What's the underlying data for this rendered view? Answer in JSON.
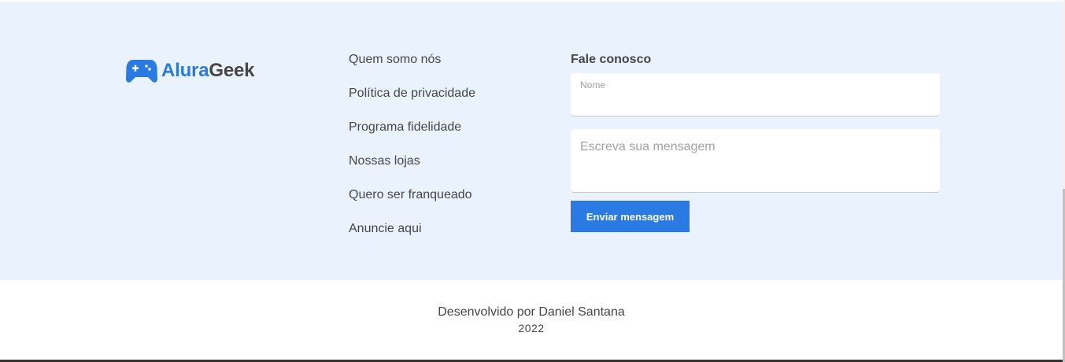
{
  "brand": {
    "name_part1": "Alura",
    "name_part2": "Geek",
    "icon": "gamepad-icon",
    "colors": {
      "accent": "#2a7ae4",
      "text": "#464646",
      "footer_bg": "#eaf2fd"
    }
  },
  "footer_links": [
    {
      "label": "Quem somo nós"
    },
    {
      "label": "Política de privacidade"
    },
    {
      "label": "Programa fidelidade"
    },
    {
      "label": "Nossas lojas"
    },
    {
      "label": "Quero ser franqueado"
    },
    {
      "label": "Anuncie aqui"
    }
  ],
  "contact": {
    "heading": "Fale conosco",
    "name_label": "Nome",
    "name_value": "",
    "message_placeholder": "Escreva sua mensagem",
    "submit_label": "Enviar mensagem"
  },
  "credits": {
    "author_line": "Desenvolvido por Daniel Santana",
    "year": "2022"
  }
}
